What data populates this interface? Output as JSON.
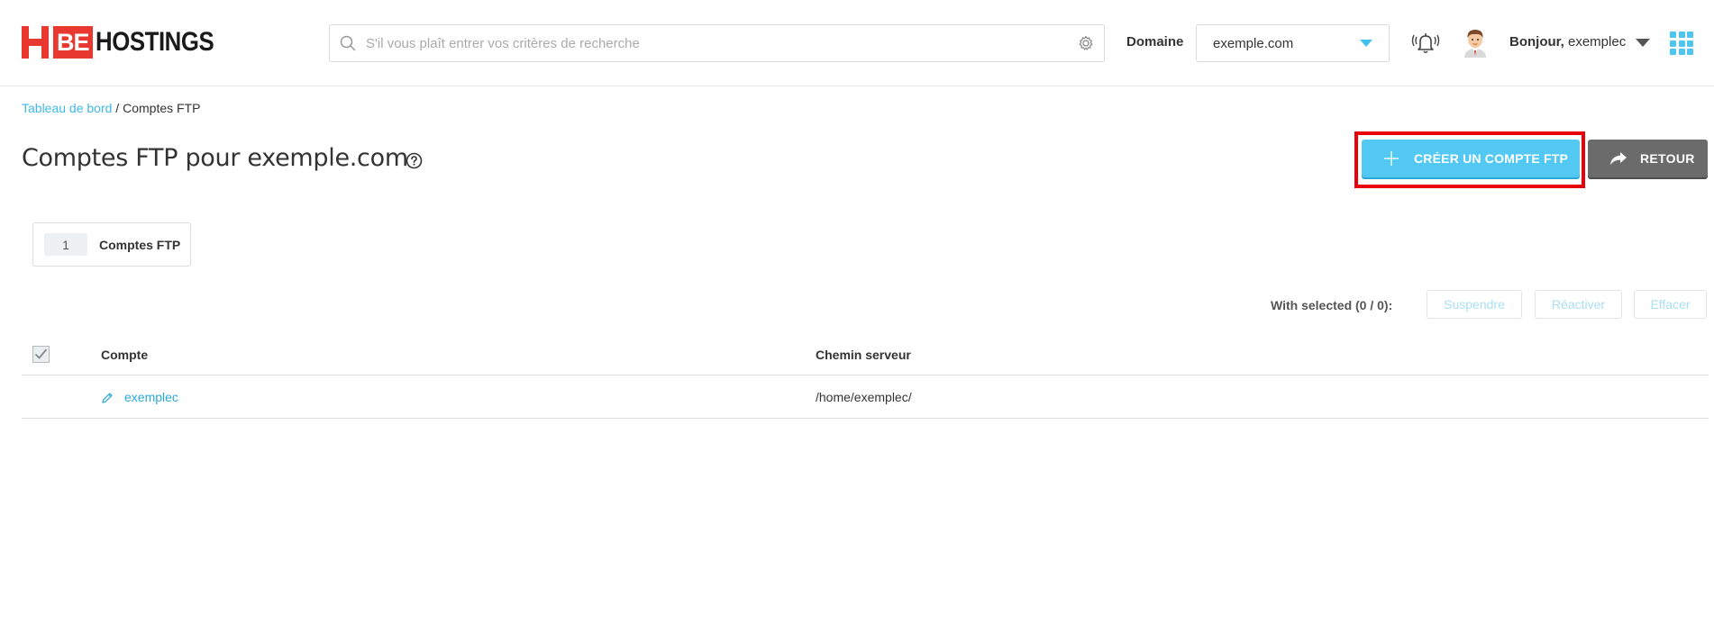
{
  "brand": {
    "logo_be": "BE",
    "logo_text": "HOSTINGS"
  },
  "search": {
    "placeholder": "S'il vous plaît entrer vos critères de recherche",
    "value": ""
  },
  "header": {
    "domain_label": "Domaine",
    "domain_value": "exemple.com",
    "greeting_bold": "Bonjour,",
    "greeting_user": "exemplec"
  },
  "breadcrumb": {
    "home": "Tableau de bord",
    "separator": " / ",
    "current": "Comptes FTP"
  },
  "page": {
    "title": "Comptes FTP pour exemple.com",
    "create_button": "CRÉER UN COMPTE FTP",
    "back_button": "RETOUR"
  },
  "tabs": [
    {
      "count": "1",
      "label": "Comptes FTP"
    }
  ],
  "bulk": {
    "with_selected": "With selected (0 / 0):",
    "suspend": "Suspendre",
    "reactivate": "Réactiver",
    "delete": "Effacer"
  },
  "table": {
    "columns": [
      "Compte",
      "Chemin serveur"
    ],
    "rows": [
      {
        "account": "exemplec",
        "path": "/home/exemplec/"
      }
    ]
  },
  "colors": {
    "accent": "#52c8f2",
    "brand_red": "#e8382f",
    "highlight": "#e8000b",
    "back_button": "#6b6b6b"
  },
  "icons": [
    "search-icon",
    "gear-icon",
    "chevron-down-icon",
    "bell-icon",
    "avatar",
    "apps-grid-icon",
    "help-icon",
    "plus-icon",
    "share-arrow-icon",
    "checkbox-icon",
    "pencil-icon"
  ]
}
